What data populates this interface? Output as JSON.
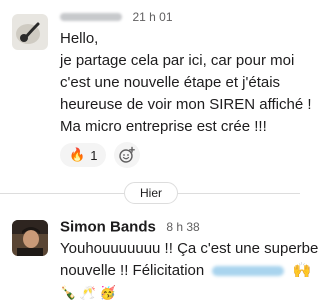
{
  "messages": [
    {
      "author": "",
      "time": "21 h 01",
      "lines": [
        "Hello,",
        "je partage cela par ici, car pour moi",
        "c'est une nouvelle étape et j'étais",
        "heureuse de voir mon SIREN affiché !",
        "Ma micro entreprise est crée !!!"
      ],
      "reactions": [
        {
          "emoji": "🔥",
          "count": "1"
        }
      ]
    },
    {
      "author": "Simon Bands",
      "time": "8 h 38",
      "line1": "Youhouuuuuuu !! Ça c'est une superbe",
      "line2_before": "nouvelle !! Félicitation",
      "line2_after": "🙌",
      "line3": "🍾 🥂 🥳"
    }
  ],
  "day_divider": "Hier",
  "icons": {
    "add_reaction": "add-reaction-icon"
  }
}
